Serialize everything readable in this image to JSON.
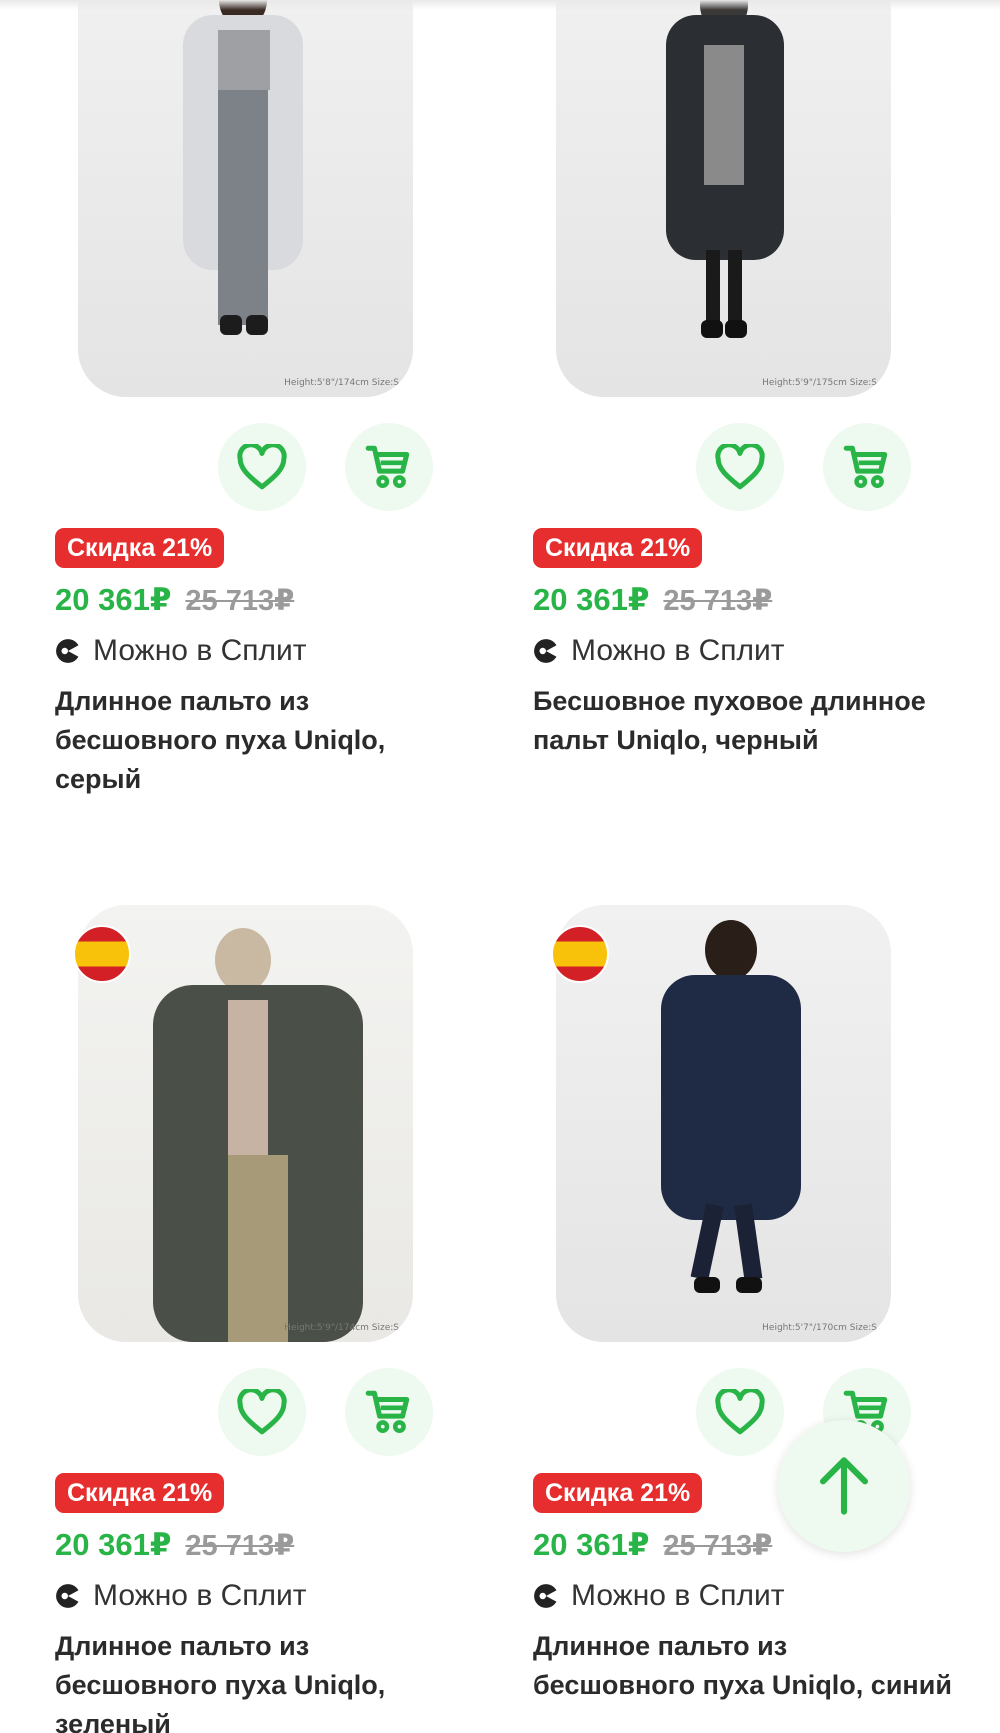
{
  "colors": {
    "accent_green": "#28b446",
    "discount_red": "#e62e2e",
    "button_bg": "#eef9ef",
    "old_price_grey": "#9a9a9a"
  },
  "products": [
    {
      "discount": "Скидка 21%",
      "price": "20 361₽",
      "old_price": "25 713₽",
      "split": "Можно в Сплит",
      "title": "Длинное пальто из бесшовного пуха Uniqlo, серый",
      "size_note": "Height:5'8\"/174cm Size:S",
      "coat_color": "#d9dadd",
      "icons": {
        "favorite": "heart-icon",
        "cart": "cart-icon",
        "split": "split-icon",
        "country": "spain-flag-icon"
      }
    },
    {
      "discount": "Скидка 21%",
      "price": "20 361₽",
      "old_price": "25 713₽",
      "split": "Можно в Сплит",
      "title": "Бесшовное пуховое длинное пальт Uniqlo, черный",
      "size_note": "Height:5'9\"/175cm Size:S",
      "coat_color": "#2b2e33",
      "icons": {
        "favorite": "heart-icon",
        "cart": "cart-icon",
        "split": "split-icon",
        "country": "spain-flag-icon"
      }
    },
    {
      "discount": "Скидка 21%",
      "price": "20 361₽",
      "old_price": "25 713₽",
      "split": "Можно в Сплит",
      "title": "Длинное пальто из бесшовного пуха Uniqlo, зеленый",
      "size_note": "Height:5'9\"/174cm Size:S",
      "coat_color": "#4a5047",
      "icons": {
        "favorite": "heart-icon",
        "cart": "cart-icon",
        "split": "split-icon",
        "country": "spain-flag-icon"
      }
    },
    {
      "discount": "Скидка 21%",
      "price": "20 361₽",
      "old_price": "25 713₽",
      "split": "Можно в Сплит",
      "title": "Длинное пальто из бесшовного пуха Uniqlo, синий",
      "size_note": "Height:5'7\"/170cm Size:S",
      "coat_color": "#1f2a44",
      "icons": {
        "favorite": "heart-icon",
        "cart": "cart-icon",
        "split": "split-icon",
        "country": "spain-flag-icon"
      }
    }
  ],
  "scroll_top": {
    "icon": "arrow-up-icon"
  }
}
